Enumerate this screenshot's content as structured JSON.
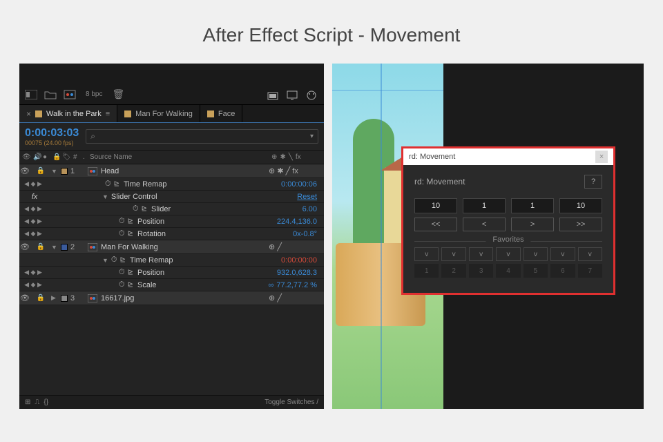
{
  "title": "After Effect Script - Movement",
  "left_panel": {
    "toolbar": {
      "bpc": "8 bpc"
    },
    "tabs": [
      {
        "label": "Walk in the Park",
        "active": true
      },
      {
        "label": "Man For Walking",
        "active": false
      },
      {
        "label": "Face",
        "active": false
      }
    ],
    "timecode": "0:00:03:03",
    "timecode_sub": "00075 (24.00 fps)",
    "columns": {
      "hash": "#",
      "dot": ".",
      "source": "Source Name"
    },
    "layers": [
      {
        "num": "1",
        "name": "Head",
        "swatch": "swatch",
        "right": "⊕ ✱ ╱ fx",
        "props": [
          {
            "name": "Time Remap",
            "value": "0:00:00:06",
            "class": "",
            "stopwatch": true,
            "kf": true
          },
          {
            "name": "Slider Control",
            "value": "Reset",
            "class": "link",
            "tri": true,
            "fx_row": true
          },
          {
            "name": "Slider",
            "value": "6.00",
            "indent": 2,
            "stopwatch": true,
            "kf": true
          },
          {
            "name": "Position",
            "value": "224.4,136.0",
            "indent": 1,
            "stopwatch": true,
            "kf": true
          },
          {
            "name": "Rotation",
            "value": "0x-0.8°",
            "indent": 1,
            "stopwatch": true,
            "kf": true
          }
        ]
      },
      {
        "num": "2",
        "name": "Man For Walking",
        "swatch": "swatch-blue",
        "right": "⊕ ╱",
        "props": [
          {
            "name": "Time Remap",
            "value": "0:00:00:00",
            "class": "red",
            "stopwatch": true,
            "tri": true
          },
          {
            "name": "Position",
            "value": "932.0,628.3",
            "indent": 1,
            "stopwatch": true,
            "kf": true
          },
          {
            "name": "Scale",
            "value": "77.2,77.2 %",
            "indent": 1,
            "stopwatch": true,
            "kf": true,
            "link_icon": "∞"
          }
        ]
      },
      {
        "num": "3",
        "name": "16617.jpg",
        "swatch": "swatch-grey",
        "right": "⊕ ╱",
        "props": []
      }
    ],
    "fx_label": "fx",
    "footer": "Toggle Switches / "
  },
  "movement": {
    "titlebar": "rd: Movement",
    "header": "rd: Movement",
    "help": "?",
    "fields": [
      "10",
      "1",
      "1",
      "10"
    ],
    "nav": [
      "<<",
      "<",
      ">",
      ">>"
    ],
    "fav_label": "Favorites",
    "fav_v": [
      "v",
      "v",
      "v",
      "v",
      "v",
      "v",
      "v"
    ],
    "fav_n": [
      "1",
      "2",
      "3",
      "4",
      "5",
      "6",
      "7"
    ]
  }
}
